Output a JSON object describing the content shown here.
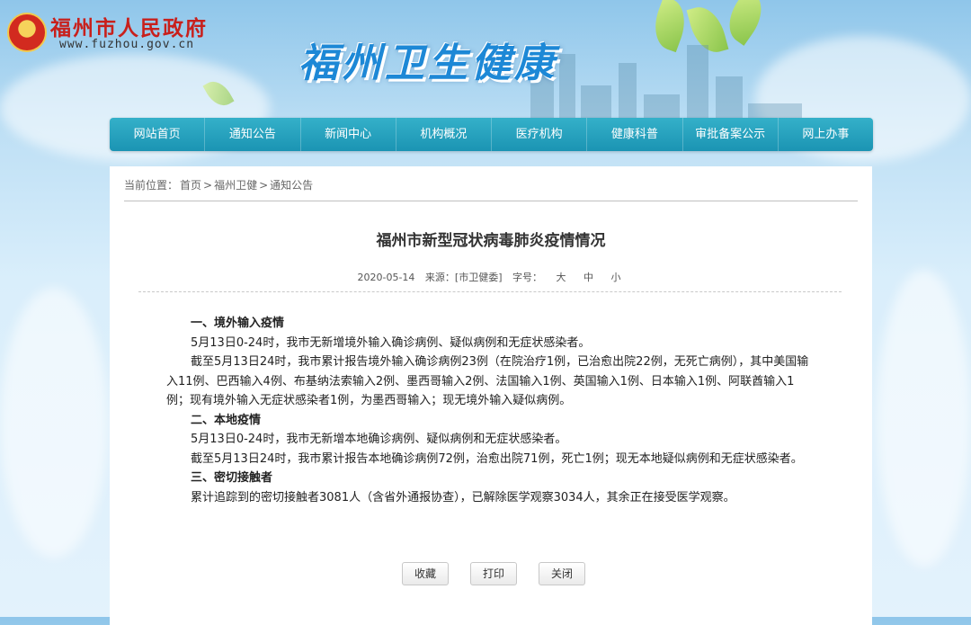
{
  "header": {
    "gov_name": "福州市人民政府",
    "gov_url": "www.fuzhou.gov.cn",
    "site_title": "福州卫生健康"
  },
  "nav": {
    "items": [
      "网站首页",
      "通知公告",
      "新闻中心",
      "机构概况",
      "医疗机构",
      "健康科普",
      "审批备案公示",
      "网上办事"
    ]
  },
  "breadcrumb": {
    "prefix": "当前位置：",
    "home": "首页",
    "sep1": ">",
    "section": "福州卫健",
    "sep2": ">",
    "current": "通知公告"
  },
  "article": {
    "title": "福州市新型冠状病毒肺炎疫情情况",
    "date": "2020-05-14",
    "source": "来源：[市卫健委]",
    "font_size_label": "字号：",
    "font_large": "大",
    "font_medium": "中",
    "font_small": "小",
    "sections": [
      {
        "heading": "一、境外输入疫情",
        "paragraphs": [
          "5月13日0-24时，我市无新增境外输入确诊病例、疑似病例和无症状感染者。",
          "截至5月13日24时，我市累计报告境外输入确诊病例23例（在院治疗1例，已治愈出院22例，无死亡病例），其中美国输入11例、巴西输入4例、布基纳法索输入2例、墨西哥输入2例、法国输入1例、英国输入1例、日本输入1例、阿联酋输入1例；现有境外输入无症状感染者1例，为墨西哥输入；现无境外输入疑似病例。"
        ]
      },
      {
        "heading": "二、本地疫情",
        "paragraphs": [
          "5月13日0-24时，我市无新增本地确诊病例、疑似病例和无症状感染者。",
          "截至5月13日24时，我市累计报告本地确诊病例72例，治愈出院71例，死亡1例；现无本地疑似病例和无症状感染者。"
        ]
      },
      {
        "heading": "三、密切接触者",
        "paragraphs": [
          "累计追踪到的密切接触者3081人（含省外通报协查），已解除医学观察3034人，其余正在接受医学观察。"
        ]
      }
    ]
  },
  "actions": {
    "favorite": "收藏",
    "print": "打印",
    "close": "关闭"
  },
  "colors": {
    "nav_bg": "#1b94b3",
    "gov_red": "#c8201c",
    "site_title_blue": "#1d88d6"
  }
}
